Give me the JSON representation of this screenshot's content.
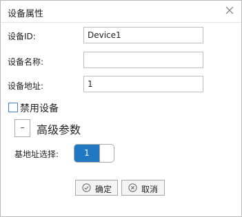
{
  "dialog": {
    "title": "设备属性",
    "close_icon": "close-icon"
  },
  "fields": {
    "device_id": {
      "label": "设备ID:",
      "value": "Device1"
    },
    "device_name": {
      "label": "设备名称:",
      "value": ""
    },
    "device_address": {
      "label": "设备地址:",
      "value": "1"
    }
  },
  "disable_device": {
    "label": "禁用设备",
    "checked": false
  },
  "advanced": {
    "expander_symbol": "-",
    "label": "高级参数"
  },
  "base_address": {
    "label": "基地址选择:",
    "value": "1",
    "on": true
  },
  "buttons": {
    "ok": {
      "label": "确定",
      "icon": "check-circle-icon"
    },
    "cancel": {
      "label": "取消",
      "icon": "x-circle-icon"
    }
  },
  "colors": {
    "accent": "#1f78c1",
    "checkbox_border": "#3c7fc4"
  }
}
